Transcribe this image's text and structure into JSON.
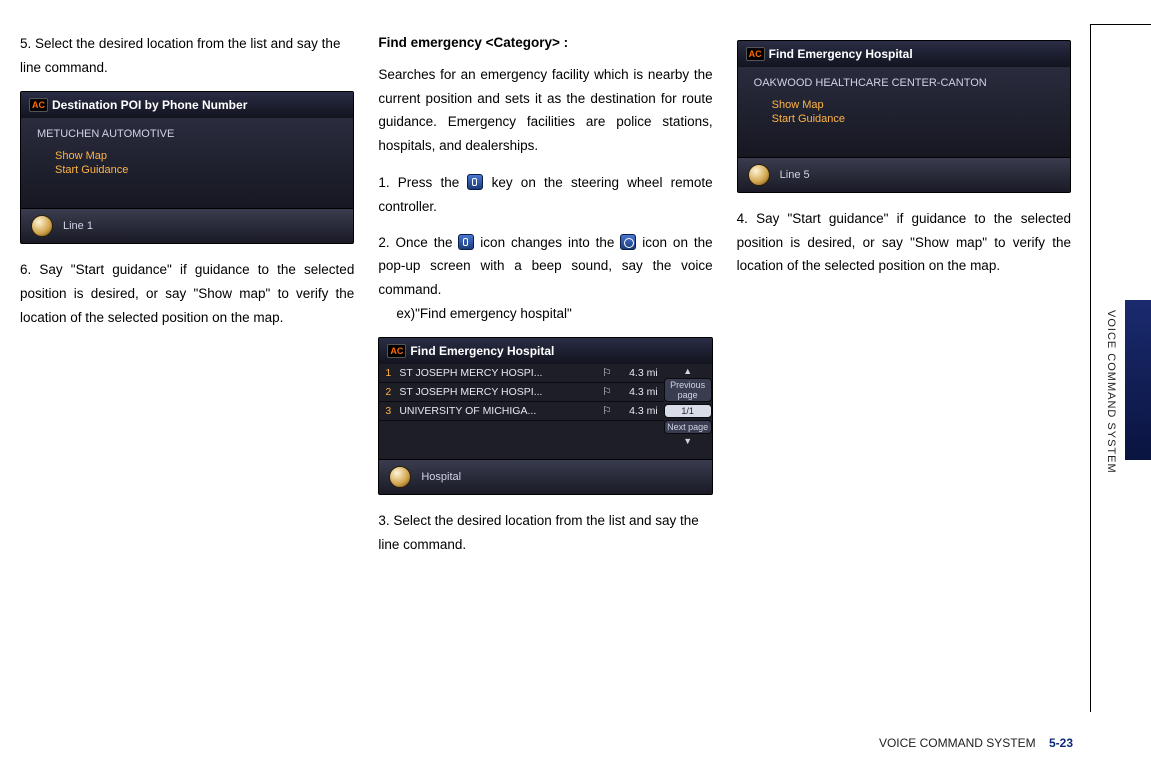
{
  "sideLabel": "VOICE COMMAND SYSTEM",
  "footer": {
    "section": "VOICE COMMAND SYSTEM",
    "page": "5-23"
  },
  "col1": {
    "step5": {
      "num": "5.",
      "text": "Select the desired location from the list and say the line command."
    },
    "shot1": {
      "ac": "AC",
      "title": "Destination POI by Phone Number",
      "label": "METUCHEN AUTOMOTIVE",
      "opt1": "Show Map",
      "opt2": "Start Guidance",
      "foot": "Line 1"
    },
    "step6": {
      "num": "6.",
      "text": "Say \"Start guidance\" if guidance to the selected position is desired, or say \"Show map\" to verify the location of the selected position on the map."
    }
  },
  "col2": {
    "heading": "Find emergency <Category> :",
    "intro": "Searches for an emergency facility which is nearby the current position and sets it as the destination for route guidance. Emergency facilities are police stations, hospitals, and dealerships.",
    "step1": {
      "num": "1.",
      "before": "Press the ",
      "after": " key on the steering wheel remote controller."
    },
    "step2": {
      "num": "2.",
      "p1a": "Once the ",
      "p1b": " icon changes into the ",
      "p1c": " icon on the pop-up screen with a beep sound, say the voice command.",
      "ex": "ex)\"Find emergency hospital\""
    },
    "shot2": {
      "ac": "AC",
      "title": "Find Emergency Hospital",
      "rows": [
        {
          "idx": "1",
          "name": "ST JOSEPH MERCY HOSPI...",
          "dist": "4.3 mi"
        },
        {
          "idx": "2",
          "name": "ST JOSEPH MERCY HOSPI...",
          "dist": "4.3 mi"
        },
        {
          "idx": "3",
          "name": "UNIVERSITY OF MICHIGA...",
          "dist": "4.3 mi"
        }
      ],
      "pagerPrev": "Previous page",
      "pagerCount": "1/1",
      "pagerNext": "Next page",
      "foot": "Hospital"
    },
    "step3": {
      "num": "3.",
      "text": "Select the desired location from the list and say the line command."
    }
  },
  "col3": {
    "shot3": {
      "ac": "AC",
      "title": "Find Emergency Hospital",
      "label": "OAKWOOD HEALTHCARE CENTER-CANTON",
      "opt1": "Show Map",
      "opt2": "Start Guidance",
      "foot": "Line 5"
    },
    "step4": {
      "num": "4.",
      "text": "Say \"Start guidance\" if guidance to the selected position is desired, or say \"Show map\" to verify the location of the selected position on the map."
    }
  }
}
